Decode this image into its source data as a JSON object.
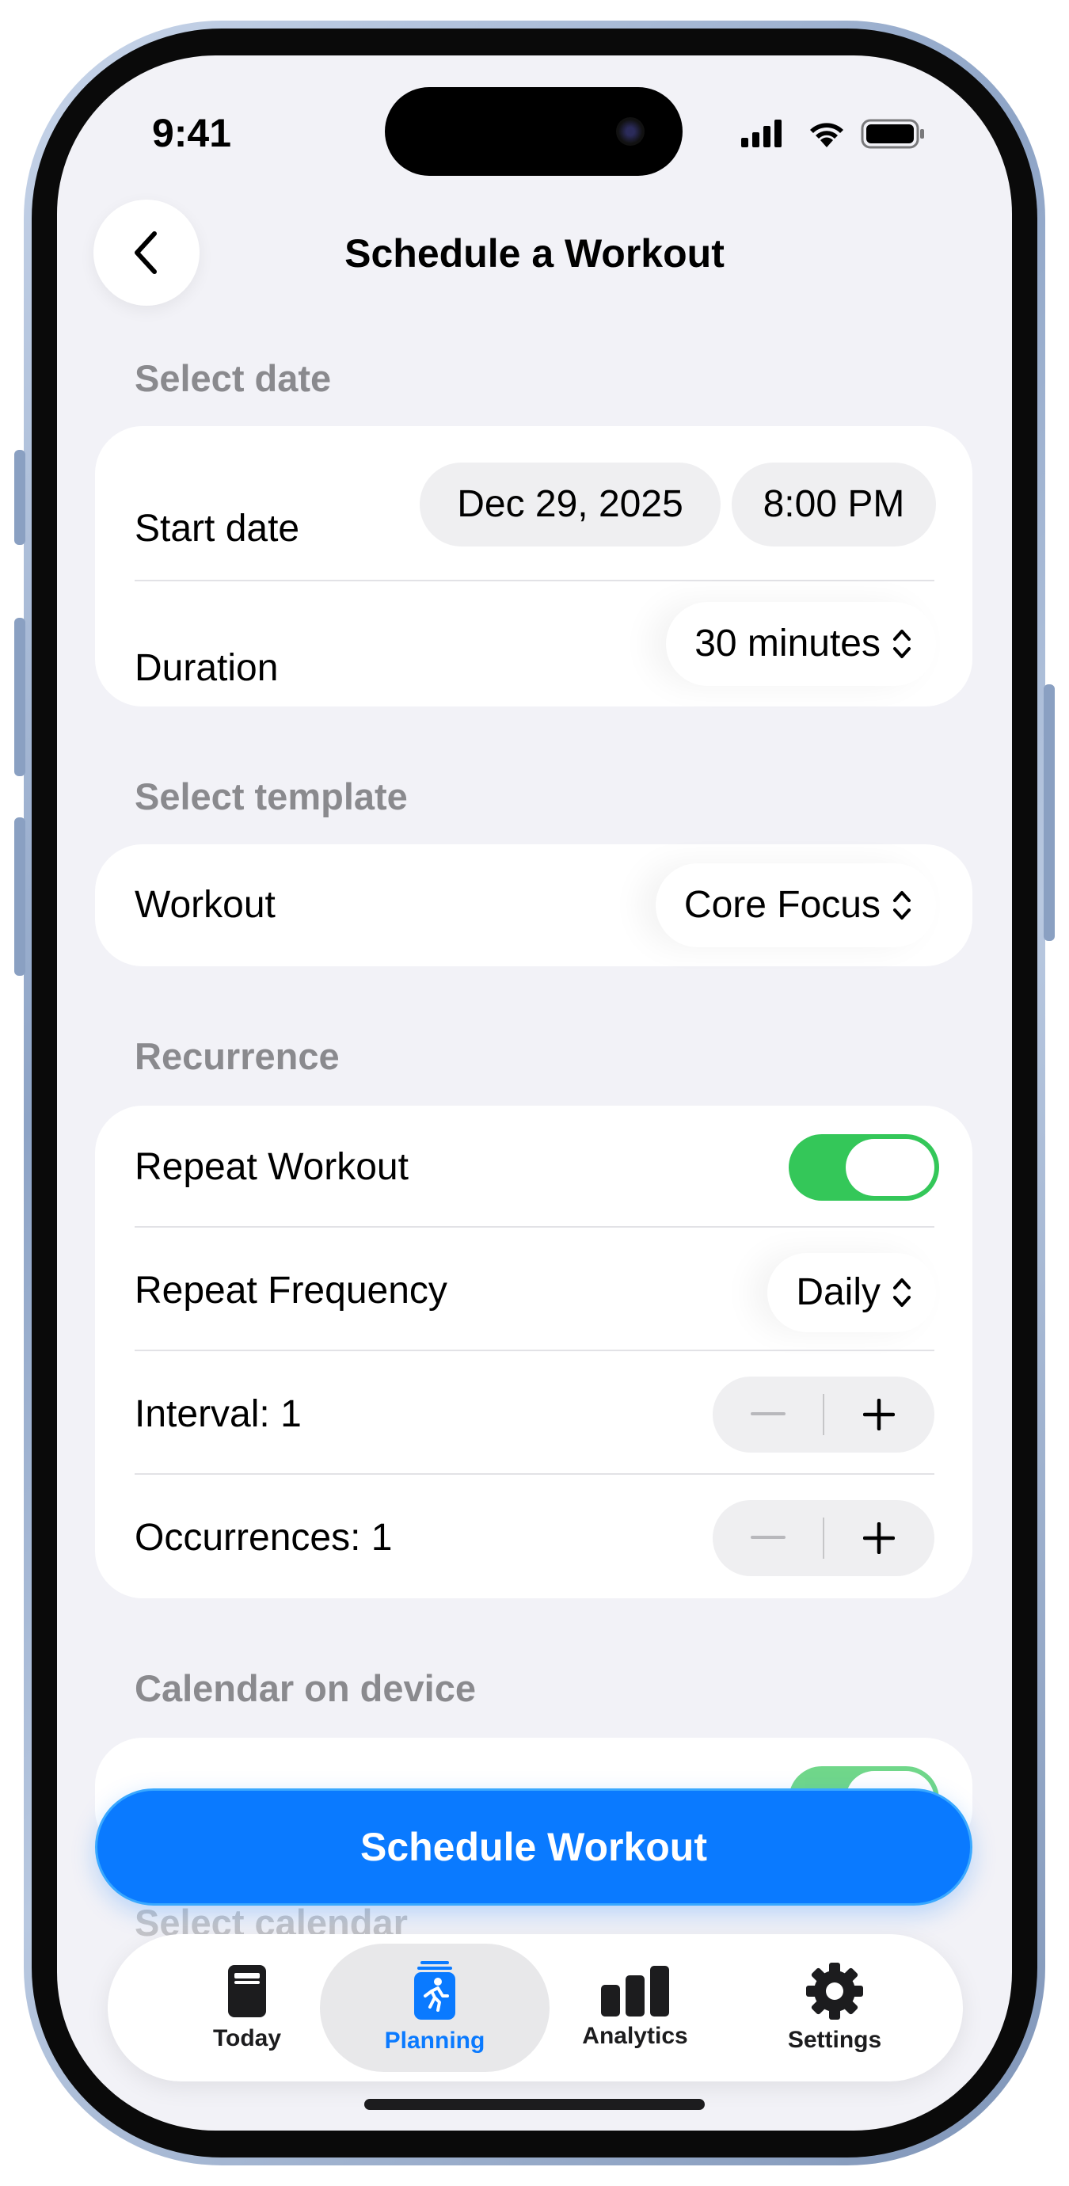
{
  "status_bar": {
    "time": "9:41"
  },
  "header": {
    "title": "Schedule a Workout"
  },
  "sections": {
    "date": {
      "label": "Select date",
      "start_date_label": "Start date",
      "start_date_value": "Dec 29, 2025",
      "start_time_value": "8:00 PM",
      "duration_label": "Duration",
      "duration_value": "30 minutes"
    },
    "template": {
      "label": "Select template",
      "workout_label": "Workout",
      "workout_value": "Core Focus"
    },
    "recurrence": {
      "label": "Recurrence",
      "repeat_label": "Repeat Workout",
      "repeat_on": true,
      "frequency_label": "Repeat Frequency",
      "frequency_value": "Daily",
      "interval_label": "Interval: 1",
      "occurrences_label": "Occurrences: 1"
    },
    "calendar": {
      "label": "Calendar on device",
      "select_calendar_label": "Select calendar"
    }
  },
  "cta": {
    "label": "Schedule Workout"
  },
  "tabbar": {
    "items": [
      {
        "label": "Today",
        "icon": "book-icon",
        "active": false
      },
      {
        "label": "Planning",
        "icon": "calendar-run-icon",
        "active": true
      },
      {
        "label": "Analytics",
        "icon": "bar-chart-icon",
        "active": false
      },
      {
        "label": "Settings",
        "icon": "gear-icon",
        "active": false
      }
    ]
  },
  "colors": {
    "accent": "#0a7aff",
    "toggle_on": "#34c759",
    "background": "#f2f2f7",
    "section_label": "#8a8a8e"
  }
}
